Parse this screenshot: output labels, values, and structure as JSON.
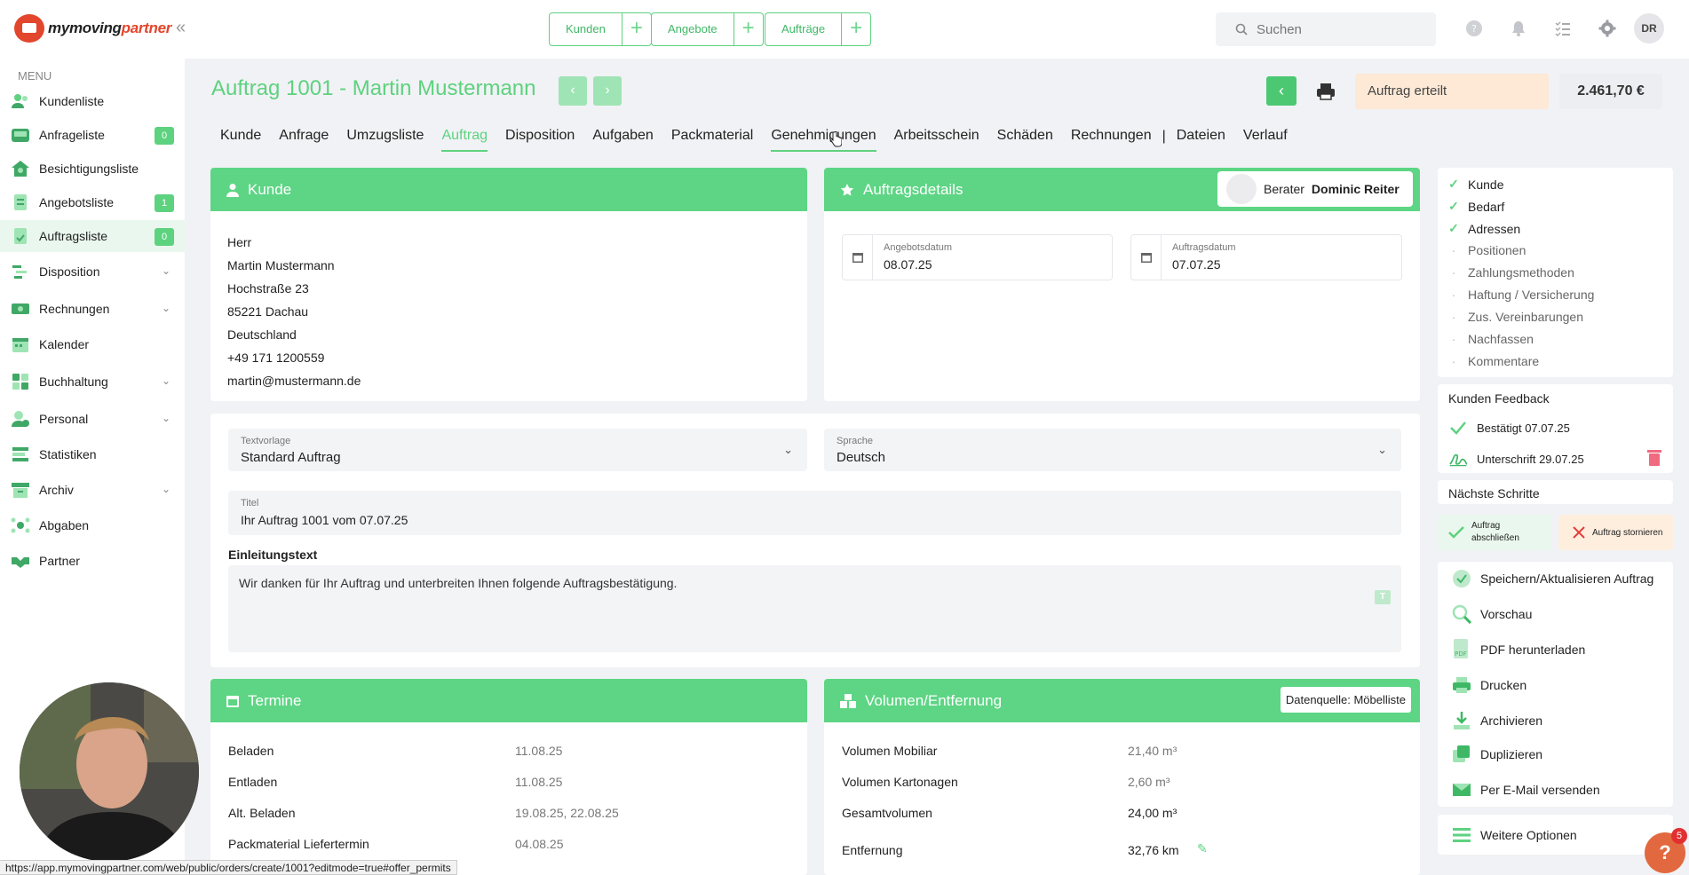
{
  "brand": {
    "name_part1": "mymoving",
    "name_part2": "partner"
  },
  "topbar": {
    "quick_links": [
      {
        "label": "Kunden"
      },
      {
        "label": "Angebote"
      },
      {
        "label": "Aufträge"
      }
    ],
    "search": {
      "placeholder": "Suchen"
    },
    "user_initials": "DR"
  },
  "sidebar": {
    "menu_label": "MENU",
    "items": [
      {
        "label": "Kundenliste"
      },
      {
        "label": "Anfrageliste",
        "badge": "0"
      },
      {
        "label": "Besichtigungsliste"
      },
      {
        "label": "Angebotsliste",
        "badge": "1"
      },
      {
        "label": "Auftragsliste",
        "badge": "0"
      },
      {
        "label": "Disposition"
      },
      {
        "label": "Rechnungen"
      },
      {
        "label": "Kalender"
      },
      {
        "label": "Buchhaltung"
      },
      {
        "label": "Personal"
      },
      {
        "label": "Statistiken"
      },
      {
        "label": "Archiv"
      },
      {
        "label": "Abgaben"
      },
      {
        "label": "Partner"
      }
    ]
  },
  "header": {
    "title": "Auftrag 1001 - Martin Mustermann",
    "status": "Auftrag erteilt",
    "price": "2.461,70 €"
  },
  "tabs": [
    {
      "label": "Kunde"
    },
    {
      "label": "Anfrage"
    },
    {
      "label": "Umzugsliste"
    },
    {
      "label": "Auftrag"
    },
    {
      "label": "Disposition"
    },
    {
      "label": "Aufgaben"
    },
    {
      "label": "Packmaterial"
    },
    {
      "label": "Genehmigungen"
    },
    {
      "label": "Arbeitsschein"
    },
    {
      "label": "Schäden"
    },
    {
      "label": "Rechnungen"
    },
    {
      "label": "Dateien"
    },
    {
      "label": "Verlauf"
    }
  ],
  "customer": {
    "title": "Kunde",
    "lines": [
      "Herr",
      "Martin Mustermann",
      "Hochstraße 23",
      "85221 Dachau",
      "Deutschland",
      "+49 171 1200559",
      "martin@mustermann.de"
    ]
  },
  "order_details": {
    "title": "Auftragsdetails",
    "advisor_label": "Berater",
    "advisor_name": "Dominic Reiter",
    "offer_date_label": "Angebotsdatum",
    "offer_date": "08.07.25",
    "order_date_label": "Auftragsdatum",
    "order_date": "07.07.25"
  },
  "text_section": {
    "template_label": "Textvorlage",
    "template_value": "Standard Auftrag",
    "language_label": "Sprache",
    "language_value": "Deutsch",
    "title_label": "Titel",
    "title_value": "Ihr Auftrag 1001 vom 07.07.25",
    "intro_label": "Einleitungstext",
    "intro_value": "Wir danken für Ihr Auftrag und unterbreiten Ihnen folgende Auftragsbestätigung."
  },
  "appointments": {
    "title": "Termine",
    "rows": [
      {
        "label": "Beladen",
        "value": "11.08.25"
      },
      {
        "label": "Entladen",
        "value": "11.08.25"
      },
      {
        "label": "Alt. Beladen",
        "value": "19.08.25, 22.08.25"
      },
      {
        "label": "Packmaterial Liefertermin",
        "value": "04.08.25"
      }
    ]
  },
  "volume": {
    "title": "Volumen/Entfernung",
    "data_source": "Datenquelle: Möbelliste",
    "rows": [
      {
        "label": "Volumen Mobiliar",
        "value": "21,40 m³"
      },
      {
        "label": "Volumen Kartonagen",
        "value": "2,60 m³"
      },
      {
        "label": "Gesamtvolumen",
        "value": "24,00 m³"
      },
      {
        "label": "Entfernung",
        "value": "32,76 km"
      }
    ]
  },
  "checklist": [
    {
      "label": "Kunde",
      "done": true
    },
    {
      "label": "Bedarf",
      "done": true
    },
    {
      "label": "Adressen",
      "done": true
    },
    {
      "label": "Positionen",
      "done": false
    },
    {
      "label": "Zahlungsmethoden",
      "done": false
    },
    {
      "label": "Haftung / Versicherung",
      "done": false
    },
    {
      "label": "Zus. Vereinbarungen",
      "done": false
    },
    {
      "label": "Nachfassen",
      "done": false
    },
    {
      "label": "Kommentare",
      "done": false
    }
  ],
  "feedback": {
    "title": "Kunden Feedback",
    "confirmed": "Bestätigt 07.07.25",
    "signature": "Unterschrift 29.07.25"
  },
  "next_steps": {
    "title": "Nächste Schritte",
    "complete_label": "Auftrag abschließen",
    "cancel_label": "Auftrag stornieren"
  },
  "actions": [
    {
      "label": "Speichern/Aktualisieren Auftrag"
    },
    {
      "label": "Vorschau"
    },
    {
      "label": "PDF herunterladen"
    },
    {
      "label": "Drucken"
    },
    {
      "label": "Archivieren"
    },
    {
      "label": "Duplizieren"
    },
    {
      "label": "Per E-Mail versenden"
    }
  ],
  "more_options": "Weitere Optionen",
  "help_badge": "5",
  "status_url": "https://app.mymovingpartner.com/web/public/orders/create/1001?editmode=true#offer_permits",
  "colors": {
    "accent": "#5dd584",
    "brand_red": "#e2462c",
    "status_bg": "#fde9d6"
  }
}
